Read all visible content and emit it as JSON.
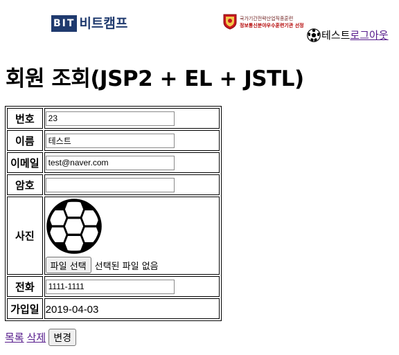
{
  "header": {
    "logo_box": "BIT",
    "logo_text": "비트캠프",
    "cert_line1": "국가기간전략산업직종훈련",
    "cert_line2": "정보통신분야우수훈련기관 선정",
    "user_name": "테스트",
    "logout_label": "로그아웃"
  },
  "page": {
    "title": "회원 조회(JSP2 + EL + JSTL)"
  },
  "form": {
    "no": {
      "label": "번호",
      "value": "23"
    },
    "name": {
      "label": "이름",
      "value": "테스트"
    },
    "email": {
      "label": "이메일",
      "value": "test@naver.com"
    },
    "password": {
      "label": "암호",
      "value": ""
    },
    "photo": {
      "label": "사진",
      "icon": "soccer-ball-icon",
      "file_button": "파일 선택",
      "file_status": "선택된 파일 없음"
    },
    "tel": {
      "label": "전화",
      "value": "1111-1111"
    },
    "created": {
      "label": "가입일",
      "value": "2019-04-03"
    }
  },
  "actions": {
    "list_label": "목록",
    "delete_label": "삭제",
    "change_label": "변경"
  },
  "colors": {
    "link": "#551a8b",
    "logo_blue": "#1f3a6e",
    "cert_red": "#b30000"
  }
}
